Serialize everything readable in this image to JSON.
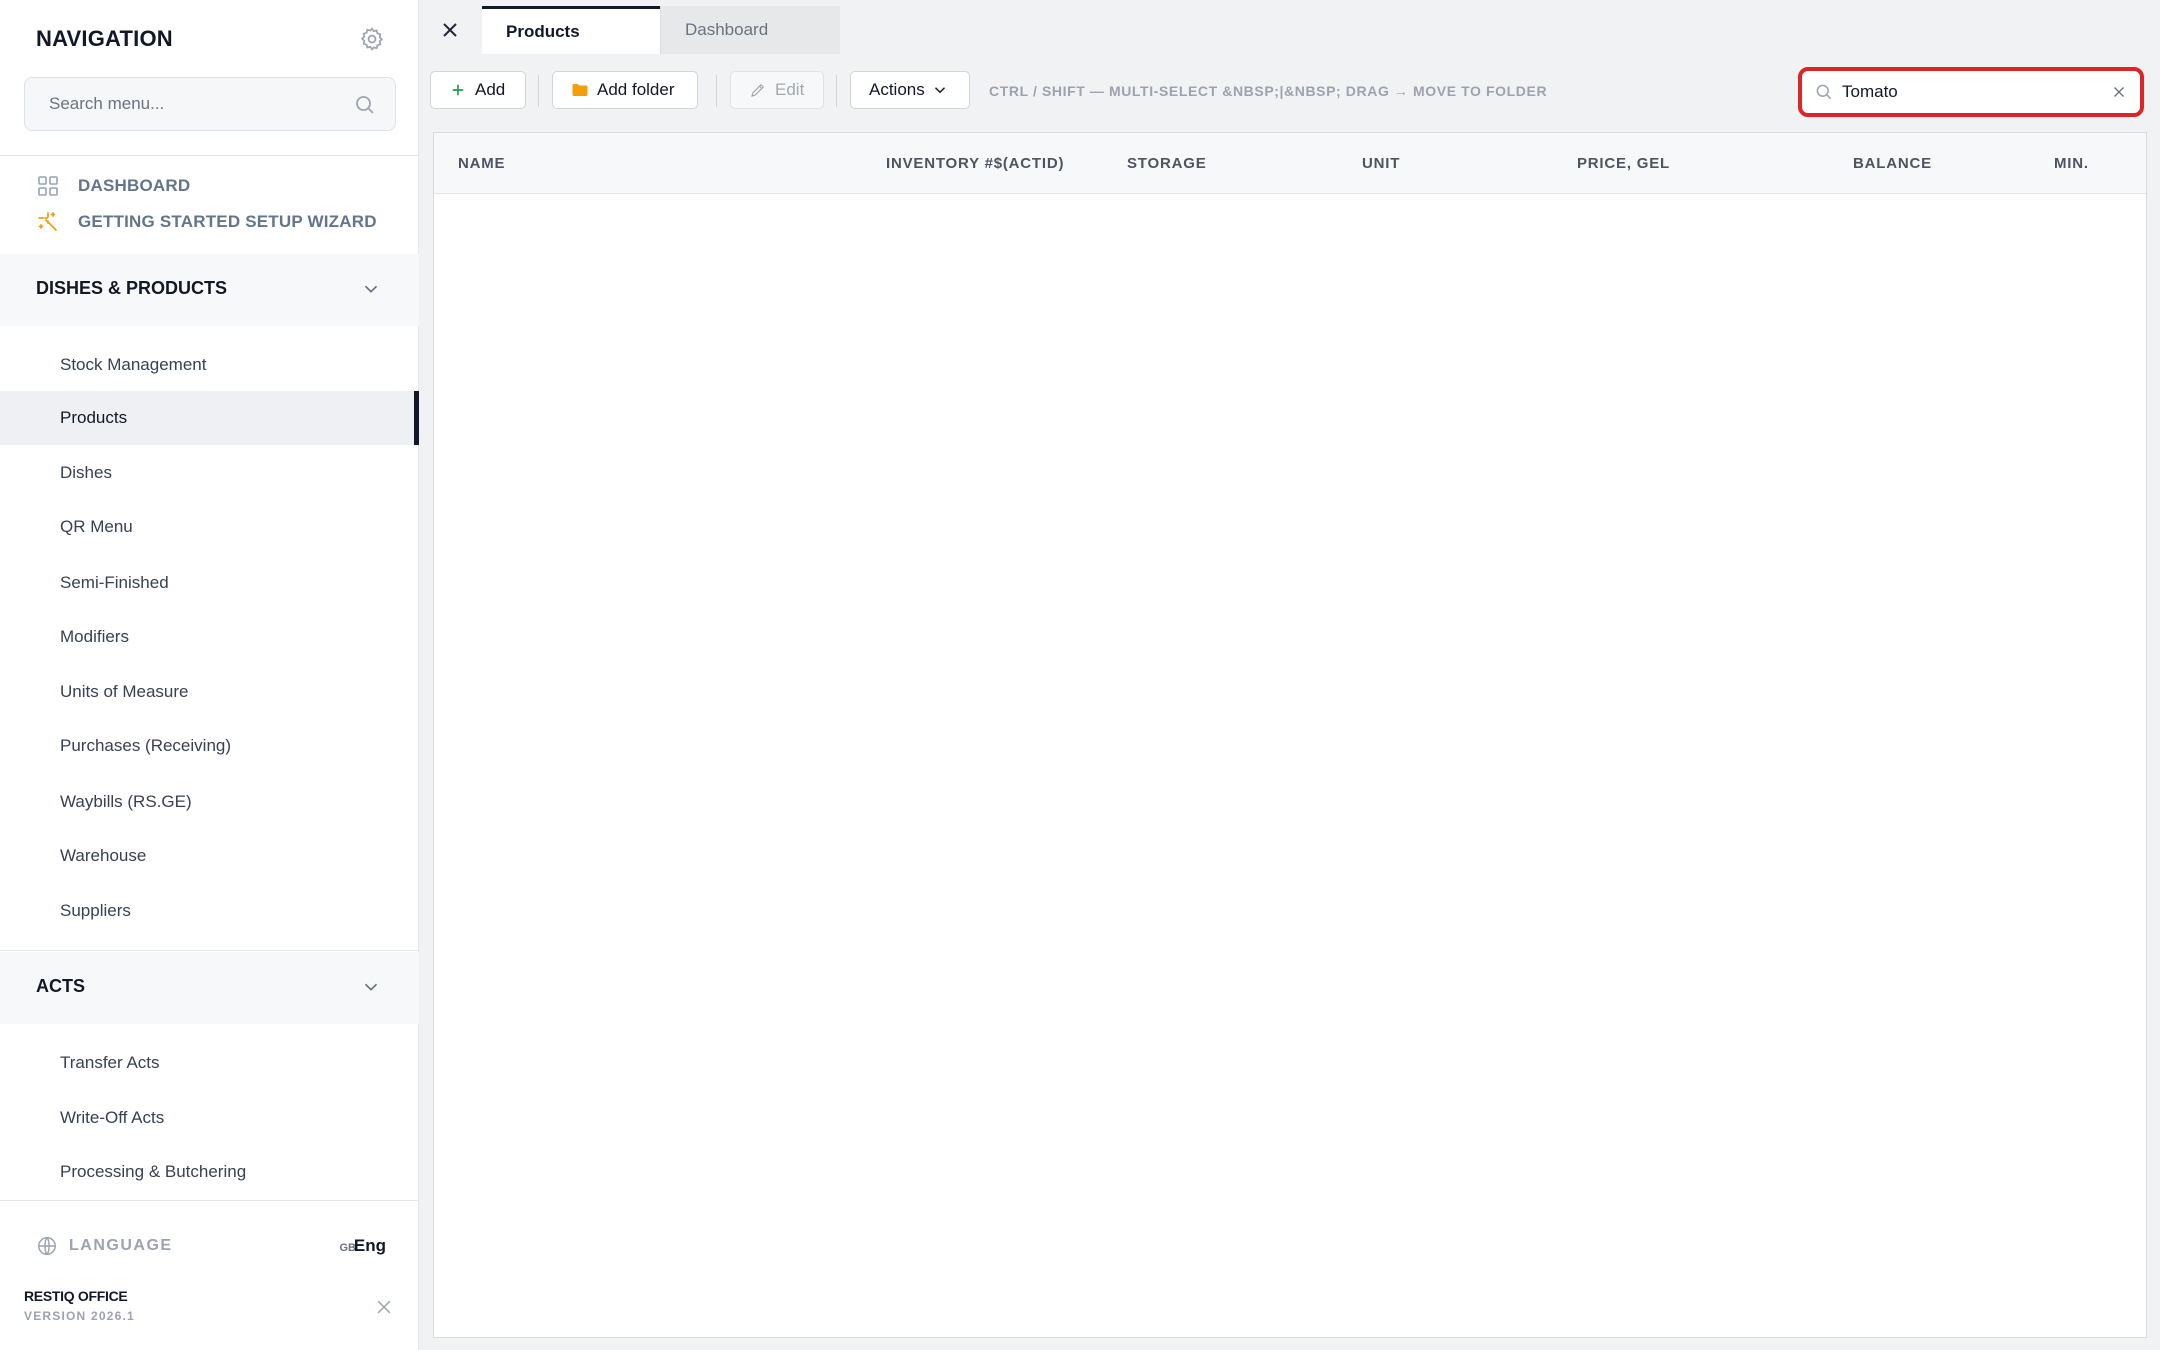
{
  "sidebar": {
    "title": "NAVIGATION",
    "search_placeholder": "Search menu...",
    "quick_links": [
      {
        "label": "DASHBOARD",
        "icon": "grid-icon"
      },
      {
        "label": "GETTING STARTED SETUP WIZARD",
        "icon": "sparkle-icon"
      }
    ],
    "sections": [
      {
        "label": "DISHES & PRODUCTS",
        "items": [
          {
            "label": "Stock Management"
          },
          {
            "label": "Products",
            "active": true
          },
          {
            "label": "Dishes"
          },
          {
            "label": "QR Menu"
          },
          {
            "label": "Semi-Finished"
          },
          {
            "label": "Modifiers"
          },
          {
            "label": "Units of Measure"
          },
          {
            "label": "Purchases (Receiving)"
          },
          {
            "label": "Waybills (RS.GE)"
          },
          {
            "label": "Warehouse"
          },
          {
            "label": "Suppliers"
          }
        ]
      },
      {
        "label": "ACTS",
        "items": [
          {
            "label": "Transfer Acts"
          },
          {
            "label": "Write-Off Acts"
          },
          {
            "label": "Processing & Butchering"
          }
        ]
      }
    ],
    "language": {
      "label": "LANGUAGE",
      "flag": "GB",
      "value": "Eng"
    },
    "brand": {
      "name": "RESTIQ OFFICE",
      "version": "VERSION 2026.1"
    }
  },
  "tabs": [
    {
      "label": "Products",
      "active": true
    },
    {
      "label": "Dashboard",
      "active": false
    }
  ],
  "toolbar": {
    "add_label": "Add",
    "add_folder_label": "Add folder",
    "edit_label": "Edit",
    "actions_label": "Actions",
    "hint": "CTRL / SHIFT — MULTI-SELECT &NBSP;|&NBSP; DRAG → MOVE TO FOLDER",
    "search_value": "Tomato"
  },
  "table": {
    "columns": [
      "NAME",
      "INVENTORY #$(ACTID)",
      "STORAGE",
      "UNIT",
      "PRICE, GEL",
      "BALANCE",
      "MIN."
    ],
    "rows": []
  },
  "colors": {
    "accent_dark": "#111827",
    "highlight_border": "#dc2626",
    "folder": "#f59e0b",
    "wizard_icon": "#f59e0b"
  }
}
